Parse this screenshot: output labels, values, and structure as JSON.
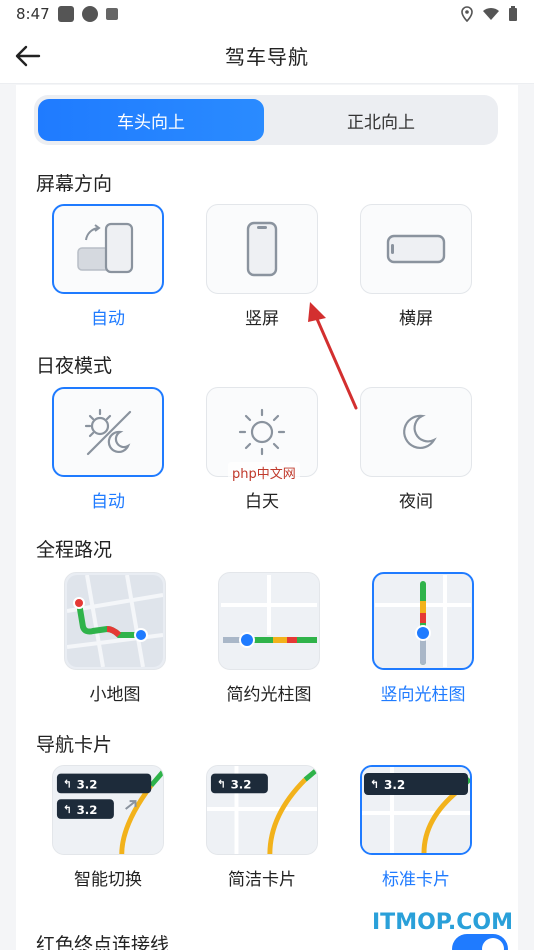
{
  "status_bar": {
    "time": "8:47"
  },
  "header": {
    "title": "驾车导航"
  },
  "orientation_mode": {
    "options": [
      "车头向上",
      "正北向上"
    ],
    "selected": "车头向上"
  },
  "sections": {
    "screen_orientation": {
      "title": "屏幕方向",
      "options": [
        "自动",
        "竖屏",
        "横屏"
      ],
      "selected": "自动"
    },
    "day_night": {
      "title": "日夜模式",
      "options": [
        "自动",
        "白天",
        "夜间"
      ],
      "selected": "自动"
    },
    "route_overview": {
      "title": "全程路况",
      "options": [
        "小地图",
        "简约光柱图",
        "竖向光柱图"
      ],
      "selected": "竖向光柱图"
    },
    "nav_card": {
      "title": "导航卡片",
      "options": [
        "智能切换",
        "简洁卡片",
        "标准卡片"
      ],
      "selected": "标准卡片",
      "card_distance": "3.2"
    },
    "red_line": {
      "title": "红色终点连接线",
      "enabled": true
    }
  },
  "watermark": {
    "php": "php中文网",
    "itmop": "ITMOP.COM"
  },
  "colors": {
    "accent": "#1f7bff",
    "annotation_arrow": "#d32f2f"
  }
}
